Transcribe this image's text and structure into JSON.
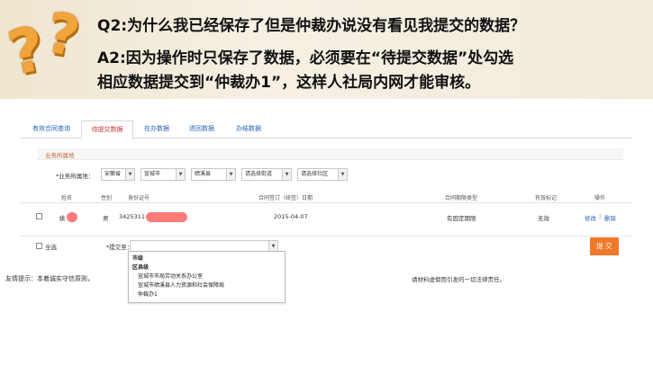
{
  "faq": {
    "question": "Q2:为什么我已经保存了但是仲裁办说没有看见我提交的数据？",
    "answer_line1": "A2:因为操作时只保存了数据，必须要在“待提交数据”处勾选",
    "answer_line2": "相应数据提交到“仲裁办1”，这样人社局内网才能审核。",
    "decor_icon": "question-marks"
  },
  "tabs": [
    {
      "label": "有效合同查询",
      "active": false
    },
    {
      "label": "待提交数据",
      "active": true
    },
    {
      "label": "在办数据",
      "active": false
    },
    {
      "label": "退回数据",
      "active": false
    },
    {
      "label": "办结数据",
      "active": false
    }
  ],
  "section": {
    "title": "业务所属地"
  },
  "filter": {
    "label": "*业务所属地：",
    "province": "安徽省",
    "city": "宣城市",
    "county": "绩溪县",
    "street": "请选择街道",
    "community": "请选择社区"
  },
  "table": {
    "columns": [
      "姓名",
      "性别",
      "身份证号",
      "合同签订（续签）日期",
      "合同期限类型",
      "有效标记",
      "操作"
    ],
    "rows": [
      {
        "name": "姚",
        "gender": "男",
        "id_prefix": "3425311",
        "date": "2015-04-07",
        "term_type": "有固定期限",
        "valid": "无效",
        "edit": "修改",
        "delete": "删除"
      }
    ]
  },
  "footer": {
    "select_all": "全选",
    "submit_to_label": "*提交至：",
    "submit_to_value": "",
    "submit_button": "提 交"
  },
  "dropdown": {
    "options": [
      {
        "text": "市级",
        "group": true
      },
      {
        "text": "区县级",
        "group": true
      },
      {
        "text": "宣城市市局劳动关系办公室",
        "group": false
      },
      {
        "text": "宣城市绩溪县人力资源和社会保障局",
        "group": false
      },
      {
        "text": "仲裁办1",
        "group": false
      }
    ]
  },
  "notice": {
    "text": "友情提示：本着诚实守信原则，",
    "text_right": "请材料虚假而引发的一切法律责任。"
  },
  "colors": {
    "accent": "#f07a2a",
    "link": "#2a62b8",
    "active_tab": "#cc3333",
    "redaction": "#ff7a7a"
  }
}
